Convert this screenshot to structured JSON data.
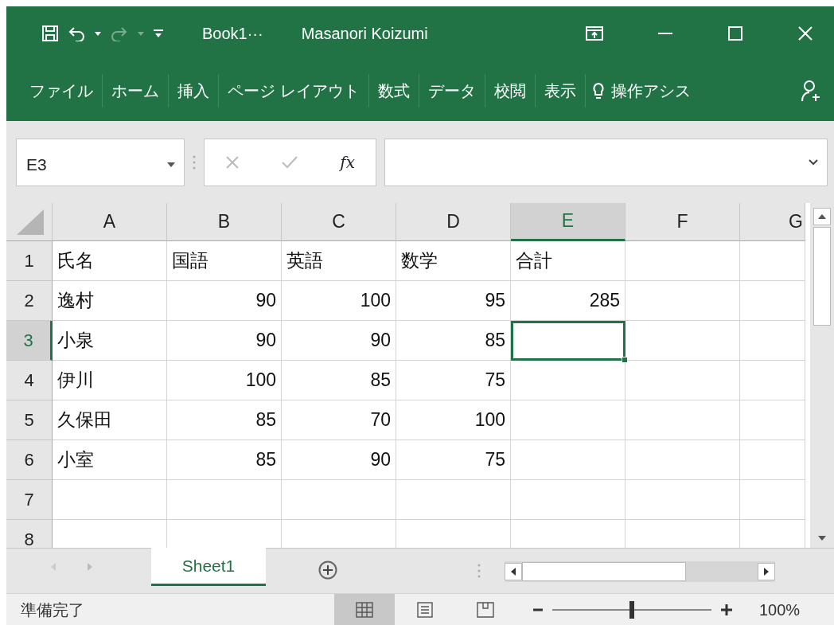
{
  "title_bar": {
    "quick_access": [
      {
        "kind": "save",
        "disabled": false
      },
      {
        "kind": "undo",
        "disabled": false
      },
      {
        "kind": "dropdown",
        "disabled": false
      },
      {
        "kind": "redo",
        "disabled": true
      },
      {
        "kind": "dropdown",
        "disabled": true
      },
      {
        "kind": "customize",
        "disabled": false
      }
    ],
    "title": "Book1···",
    "user": "Masanori Koizumi"
  },
  "ribbon_tabs": [
    "ファイル",
    "ホーム",
    "挿入",
    "ページ レイアウト",
    "数式",
    "データ",
    "校閲",
    "表示"
  ],
  "tell_me": "操作アシス",
  "formula_bar": {
    "name_box": "E3",
    "function_label": "fx"
  },
  "columns": [
    {
      "label": "A",
      "selected": false
    },
    {
      "label": "B",
      "selected": false
    },
    {
      "label": "C",
      "selected": false
    },
    {
      "label": "D",
      "selected": false
    },
    {
      "label": "E",
      "selected": true
    },
    {
      "label": "F",
      "selected": false
    },
    {
      "label": "G",
      "selected": false
    }
  ],
  "rows": [
    {
      "header": "1",
      "selected": false,
      "cells": [
        {
          "text": "氏名",
          "kind": "text"
        },
        {
          "text": "国語",
          "kind": "text"
        },
        {
          "text": "英語",
          "kind": "text"
        },
        {
          "text": "数学",
          "kind": "text"
        },
        {
          "text": "合計",
          "kind": "text"
        }
      ]
    },
    {
      "header": "2",
      "selected": false,
      "cells": [
        {
          "text": "逸村",
          "kind": "text"
        },
        {
          "text": "90",
          "kind": "number"
        },
        {
          "text": "100",
          "kind": "number"
        },
        {
          "text": "95",
          "kind": "number"
        },
        {
          "text": "285",
          "kind": "number"
        }
      ]
    },
    {
      "header": "3",
      "selected": true,
      "cells": [
        {
          "text": "小泉",
          "kind": "text"
        },
        {
          "text": "90",
          "kind": "number"
        },
        {
          "text": "90",
          "kind": "number"
        },
        {
          "text": "85",
          "kind": "number"
        }
      ]
    },
    {
      "header": "4",
      "selected": false,
      "cells": [
        {
          "text": "伊川",
          "kind": "text"
        },
        {
          "text": "100",
          "kind": "number"
        },
        {
          "text": "85",
          "kind": "number"
        },
        {
          "text": "75",
          "kind": "number"
        }
      ]
    },
    {
      "header": "5",
      "selected": false,
      "cells": [
        {
          "text": "久保田",
          "kind": "text"
        },
        {
          "text": "85",
          "kind": "number"
        },
        {
          "text": "70",
          "kind": "number"
        },
        {
          "text": "100",
          "kind": "number"
        }
      ]
    },
    {
      "header": "6",
      "selected": false,
      "cells": [
        {
          "text": "小室",
          "kind": "text"
        },
        {
          "text": "85",
          "kind": "number"
        },
        {
          "text": "90",
          "kind": "number"
        },
        {
          "text": "75",
          "kind": "number"
        }
      ]
    },
    {
      "header": "7",
      "selected": false
    },
    {
      "header": "8",
      "selected": false
    }
  ],
  "sheet_tabs": [
    {
      "label": "Sheet1",
      "selected": true
    }
  ],
  "status_bar": {
    "text": "準備完了",
    "views": [
      {
        "kind": "normal",
        "selected": true
      },
      {
        "kind": "page-layout",
        "selected": false
      },
      {
        "kind": "page-break",
        "selected": false
      }
    ],
    "zoom": {
      "level": 0.5,
      "reading": "100%"
    }
  }
}
